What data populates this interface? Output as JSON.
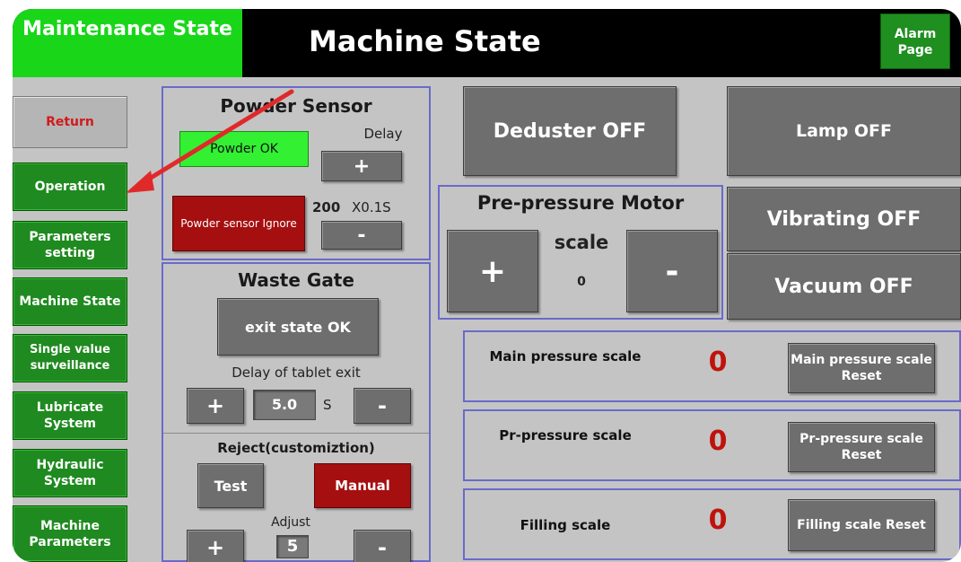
{
  "header": {
    "state_label": "Maintenance State",
    "title": "Machine State",
    "alarm_button": "Alarm Page",
    "state_color": "#19d619"
  },
  "sidebar": {
    "items": [
      {
        "label": "Return"
      },
      {
        "label": "Operation"
      },
      {
        "label": "Parameters setting"
      },
      {
        "label": "Machine State"
      },
      {
        "label": "Single value surveillance"
      },
      {
        "label": "Lubricate System"
      },
      {
        "label": "Hydraulic System"
      },
      {
        "label": "Machine Parameters"
      }
    ]
  },
  "powder_sensor": {
    "title": "Powder Sensor",
    "status": "Powder OK",
    "delay_label": "Delay",
    "plus": "+",
    "minus": "-",
    "ignore_button": "Powder sensor Ignore",
    "delay_value": "200",
    "delay_unit": "X0.1S"
  },
  "waste_gate": {
    "title": "Waste Gate",
    "exit_button": "exit state OK",
    "delay_label": "Delay of tablet exit",
    "plus": "+",
    "minus": "-",
    "value": "5.0",
    "unit": "S"
  },
  "reject": {
    "title": "Reject(customiztion)",
    "test_button": "Test",
    "manual_button": "Manual",
    "adjust_label": "Adjust",
    "adjust_value": "5",
    "plus": "+",
    "minus": "-"
  },
  "controls": {
    "deduster": "Deduster OFF",
    "lamp": "Lamp OFF",
    "vibrating": "Vibrating OFF",
    "vacuum": "Vacuum OFF"
  },
  "pre_pressure_motor": {
    "title": "Pre-pressure Motor",
    "scale_label": "scale",
    "scale_value": "0",
    "plus": "+",
    "minus": "-"
  },
  "scales": [
    {
      "label": "Main pressure scale",
      "value": "0",
      "reset": "Main pressure scale Reset"
    },
    {
      "label": "Pr-pressure scale",
      "value": "0",
      "reset": "Pr-pressure scale Reset"
    },
    {
      "label": "Filling scale",
      "value": "0",
      "reset": "Filling scale Reset"
    }
  ],
  "annotation": {
    "arrow_color": "#e02a2a"
  }
}
